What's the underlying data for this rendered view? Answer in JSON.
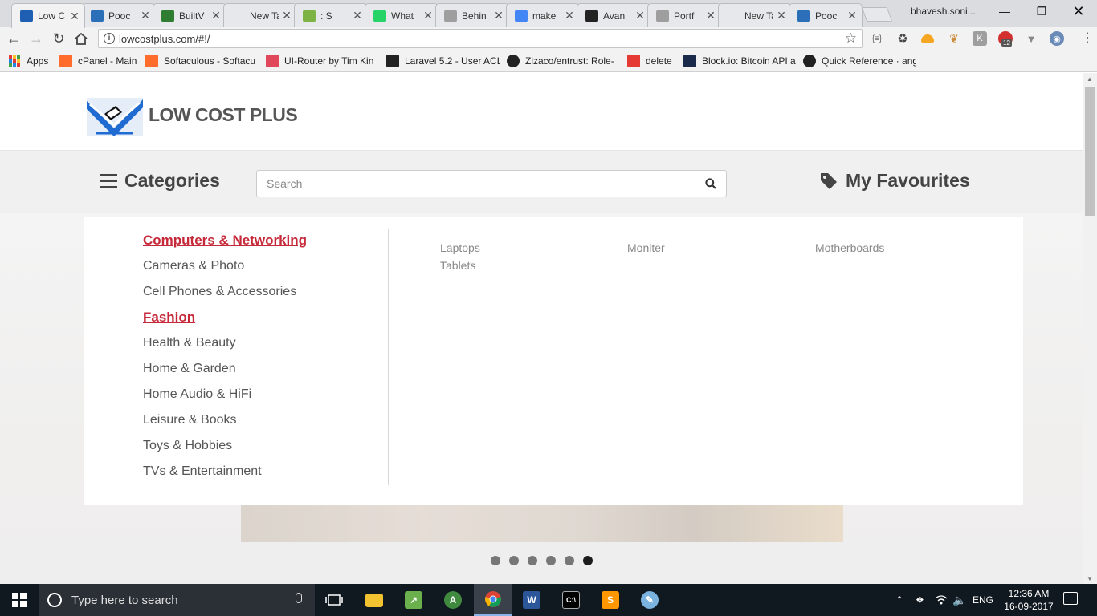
{
  "browser": {
    "tabs": [
      {
        "title": "Low C",
        "active": true,
        "favicon_color": "#1e5fb4"
      },
      {
        "title": "Pooc",
        "active": false,
        "favicon_color": "#2a6fb8"
      },
      {
        "title": "BuiltV",
        "active": false,
        "favicon_color": "#2e7d32"
      },
      {
        "title": "New Tab",
        "active": false,
        "favicon_color": ""
      },
      {
        "title": ": S",
        "active": false,
        "favicon_color": "#7cb342"
      },
      {
        "title": "What",
        "active": false,
        "favicon_color": "#25d366"
      },
      {
        "title": "Behin",
        "active": false,
        "favicon_color": "#9e9e9e"
      },
      {
        "title": "make",
        "active": false,
        "favicon_color": "#4285f4"
      },
      {
        "title": "Avan",
        "active": false,
        "favicon_color": "#222222"
      },
      {
        "title": "Portf",
        "active": false,
        "favicon_color": "#9e9e9e"
      },
      {
        "title": "New Tab",
        "active": false,
        "favicon_color": ""
      },
      {
        "title": "Pooc",
        "active": false,
        "favicon_color": "#2a6fb8"
      }
    ],
    "profile_name": "bhavesh.soni...",
    "url": "lowcostplus.com/#!/",
    "extension_badge": "12",
    "bookmarks": [
      {
        "label": "Apps",
        "icon": "apps-grid-icon",
        "color": ""
      },
      {
        "label": "cPanel - Main",
        "icon": "cpanel-icon",
        "color": "#ff6c2c"
      },
      {
        "label": "Softaculous - Softacu",
        "icon": "cpanel-icon",
        "color": "#ff6c2c"
      },
      {
        "label": "UI-Router by Tim Kin",
        "icon": "s-letter-icon",
        "color": "#e0475b"
      },
      {
        "label": "Laravel 5.2 - User ACL",
        "icon": "laravel-icon",
        "color": "#222222"
      },
      {
        "label": "Zizaco/entrust: Role-",
        "icon": "github-icon",
        "color": "#222222"
      },
      {
        "label": "delete",
        "icon": "folder-red-icon",
        "color": "#e53935"
      },
      {
        "label": "Block.io: Bitcoin API a",
        "icon": "blockio-icon",
        "color": "#1a2a4a"
      },
      {
        "label": "Quick Reference · ang",
        "icon": "github-icon",
        "color": "#222222"
      }
    ]
  },
  "site": {
    "logo_text": "LOW COST PLUS",
    "categories_label": "Categories",
    "search_placeholder": "Search",
    "favourites_label": "My Favourites",
    "categories": [
      {
        "label": "Computers & Networking",
        "highlighted": true
      },
      {
        "label": "Cameras & Photo",
        "highlighted": false
      },
      {
        "label": "Cell Phones & Accessories",
        "highlighted": false
      },
      {
        "label": "Fashion",
        "highlighted": true
      },
      {
        "label": "Health & Beauty",
        "highlighted": false
      },
      {
        "label": "Home & Garden",
        "highlighted": false
      },
      {
        "label": "Home Audio & HiFi",
        "highlighted": false
      },
      {
        "label": "Leisure & Books",
        "highlighted": false
      },
      {
        "label": "Toys & Hobbies",
        "highlighted": false
      },
      {
        "label": "TVs & Entertainment",
        "highlighted": false
      }
    ],
    "subcategories": [
      "Laptops",
      "Moniter",
      "Motherboards",
      "Tablets"
    ],
    "carousel": {
      "slide_count": 6,
      "active_index": 5
    },
    "accent_color": "#c62a3a"
  },
  "taskbar": {
    "search_placeholder": "Type here to search",
    "language": "ENG",
    "time": "12:36 AM",
    "date": "16-09-2017"
  }
}
